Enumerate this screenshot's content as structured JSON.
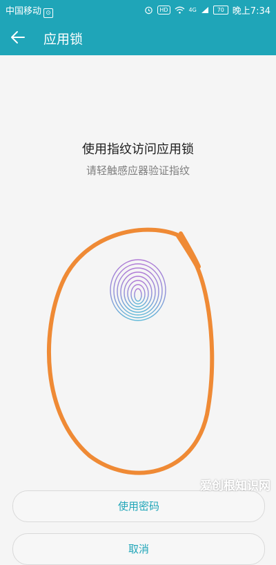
{
  "status_bar": {
    "carrier": "中国移动",
    "hd": "HD",
    "signal": "4G",
    "battery": "70",
    "time": "晚上7:34"
  },
  "app_bar": {
    "title": "应用锁"
  },
  "main": {
    "title": "使用指纹访问应用锁",
    "subtitle": "请轻触感应器验证指纹"
  },
  "buttons": {
    "use_password": "使用密码",
    "cancel": "取消"
  },
  "watermark": "爱创根知识网",
  "colors": {
    "accent": "#1fa5b8",
    "annotation": "#ef8a35"
  },
  "icons": {
    "back": "arrow-left-icon",
    "fingerprint": "fingerprint-icon",
    "alarm": "alarm-icon",
    "wifi": "wifi-icon"
  }
}
